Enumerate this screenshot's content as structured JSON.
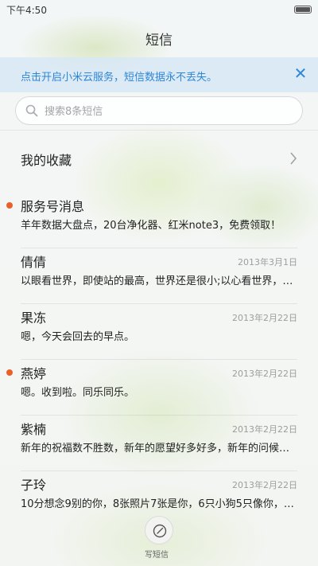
{
  "status_bar": {
    "time": "下午4:50"
  },
  "header": {
    "title": "短信"
  },
  "notice": {
    "text": "点击开启小米云服务，短信数据永不丢失。",
    "close_glyph": "✕"
  },
  "search": {
    "placeholder": "搜索8条短信",
    "value": ""
  },
  "favorites": {
    "label": "我的收藏"
  },
  "threads": [
    {
      "name": "服务号消息",
      "date": "",
      "snippet": "羊年数据大盘点，20台净化器、红米note3，免费领取！",
      "unread": true
    },
    {
      "name": "倩倩",
      "date": "2013年3月1日",
      "snippet": "以眼看世界，即使站的最高，世界还是很小;以心看世界，…",
      "unread": false
    },
    {
      "name": "果冻",
      "date": "2013年2月22日",
      "snippet": "嗯，今天会回去的早点。",
      "unread": false
    },
    {
      "name": "燕婷",
      "date": "2013年2月22日",
      "snippet": "嗯。收到啦。同乐同乐。",
      "unread": true
    },
    {
      "name": "紫楠",
      "date": "2013年2月22日",
      "snippet": "新年的祝福数不胜数，新年的愿望好多好多，新年的问候…",
      "unread": false
    },
    {
      "name": "子玲",
      "date": "2013年2月22日",
      "snippet": "10分想念9别的你，8张照片7张是你，6只小狗5只像你，4…",
      "unread": false
    }
  ],
  "compose": {
    "label": "写短信",
    "icon": "compose-icon"
  },
  "colors": {
    "accent": "#2e86d8",
    "unread_dot": "#e8612c"
  }
}
